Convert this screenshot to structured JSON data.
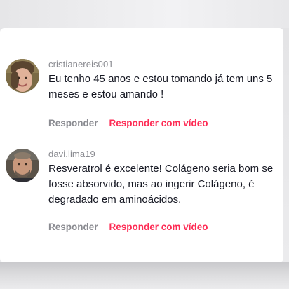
{
  "comments": [
    {
      "username": "cristianereis001",
      "text": "Eu tenho 45 anos e estou tomando já tem uns 5 meses e estou amando !",
      "reply_label": "Responder",
      "reply_video_label": "Responder com vídeo"
    },
    {
      "username": "davi.lima19",
      "text": "Resveratrol é excelente! Colágeno seria bom se fosse absorvido, mas ao ingerir Colágeno, é degradado em aminoácidos.",
      "reply_label": "Responder",
      "reply_video_label": "Responder com vídeo"
    }
  ],
  "colors": {
    "accent": "#fe2c55",
    "muted": "#8a8b91",
    "text": "#161823"
  }
}
